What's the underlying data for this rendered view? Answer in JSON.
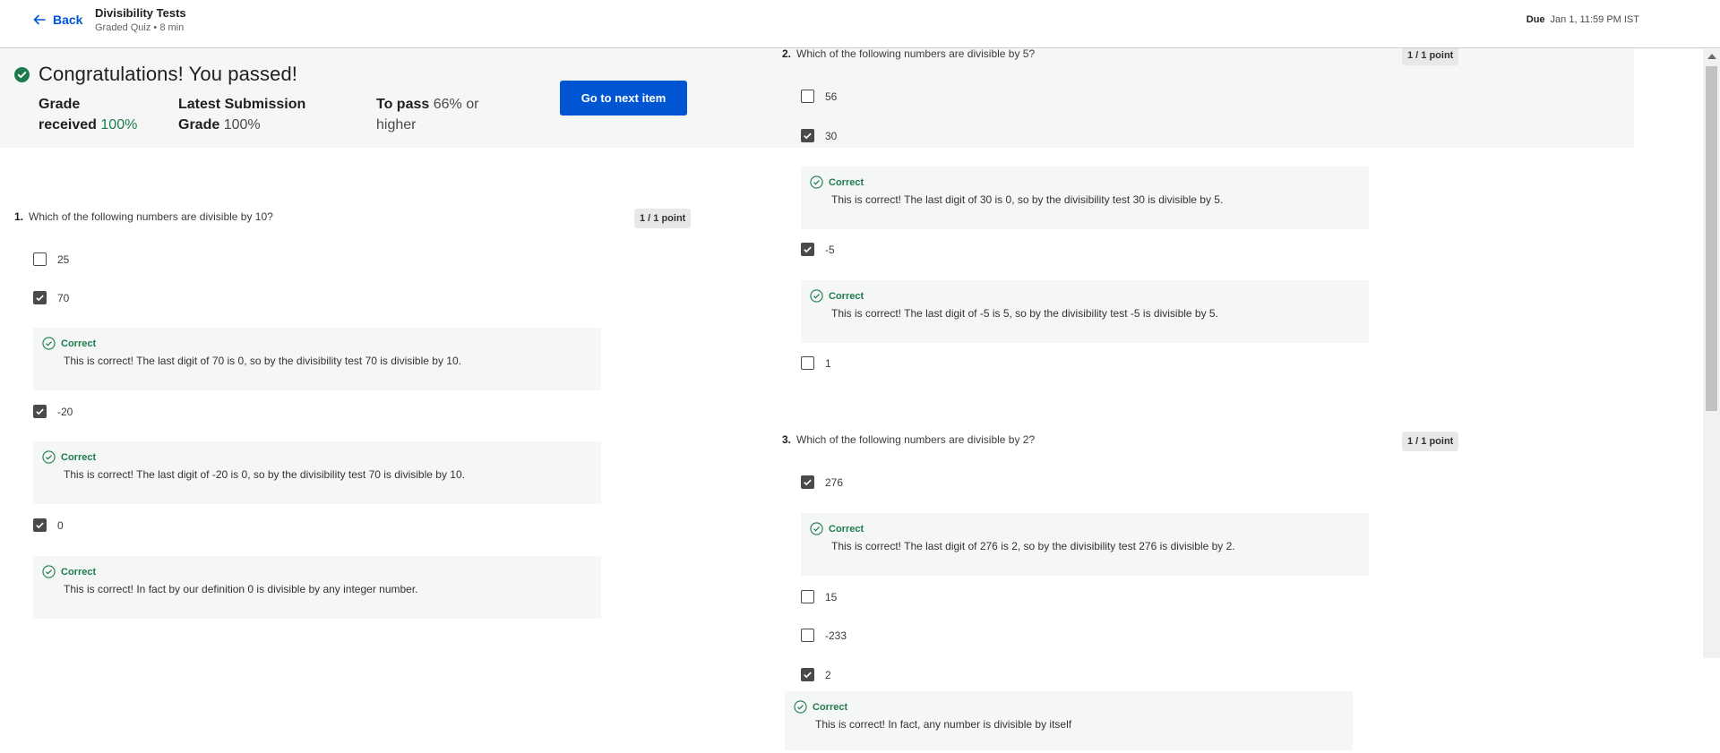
{
  "header": {
    "back_label": "Back",
    "title": "Divisibility Tests",
    "subtitle": "Graded Quiz • 8 min",
    "due_label": "Due",
    "due_value": "Jan 1, 11:59 PM IST"
  },
  "result": {
    "heading": "Congratulations! You passed!",
    "grade_label_1": "Grade",
    "grade_label_2": "received",
    "grade_value": "100%",
    "latest_label_1": "Latest Submission",
    "latest_label_2": "Grade",
    "latest_value": "100%",
    "pass_label": "To pass",
    "pass_value_1": "66% or",
    "pass_value_2": "higher",
    "next_button": "Go to next item",
    "accent_green": "#1e7b4d",
    "primary_blue": "#0056d2"
  },
  "feedback_label": "Correct",
  "questions": [
    {
      "number": "1.",
      "text": "Which of the following numbers are divisible by 10?",
      "points": "1 / 1 point",
      "options": [
        {
          "label": "25",
          "checked": false
        },
        {
          "label": "70",
          "checked": true,
          "feedback": "This is correct! The last digit of 70 is 0, so by the divisibility test 70 is divisible by 10."
        },
        {
          "label": "-20",
          "checked": true,
          "feedback": "This is correct! The last digit of -20 is 0, so by the divisibility test 70 is divisible by 10."
        },
        {
          "label": "0",
          "checked": true,
          "feedback": "This is correct! In fact by our definition 0 is divisible by any integer number."
        }
      ]
    },
    {
      "number": "2.",
      "text": "Which of the following numbers are divisible by 5?",
      "points": "1 / 1 point",
      "options": [
        {
          "label": "56",
          "checked": false
        },
        {
          "label": "30",
          "checked": true,
          "feedback": "This is correct! The last digit of 30 is 0, so by the divisibility test 30 is divisible by 5."
        },
        {
          "label": "-5",
          "checked": true,
          "feedback": "This is correct! The last digit of -5 is 5, so by the divisibility test -5 is divisible by 5."
        },
        {
          "label": "1",
          "checked": false
        }
      ]
    },
    {
      "number": "3.",
      "text": "Which of the following numbers are divisible by 2?",
      "points": "1 / 1 point",
      "options": [
        {
          "label": "276",
          "checked": true,
          "feedback": "This is correct! The last digit of 276 is 2, so by the divisibility test 276 is divisible by 2."
        },
        {
          "label": "15",
          "checked": false
        },
        {
          "label": "-233",
          "checked": false
        },
        {
          "label": "2",
          "checked": true,
          "feedback": "This is correct! In fact, any number is divisible by itself"
        }
      ]
    }
  ]
}
